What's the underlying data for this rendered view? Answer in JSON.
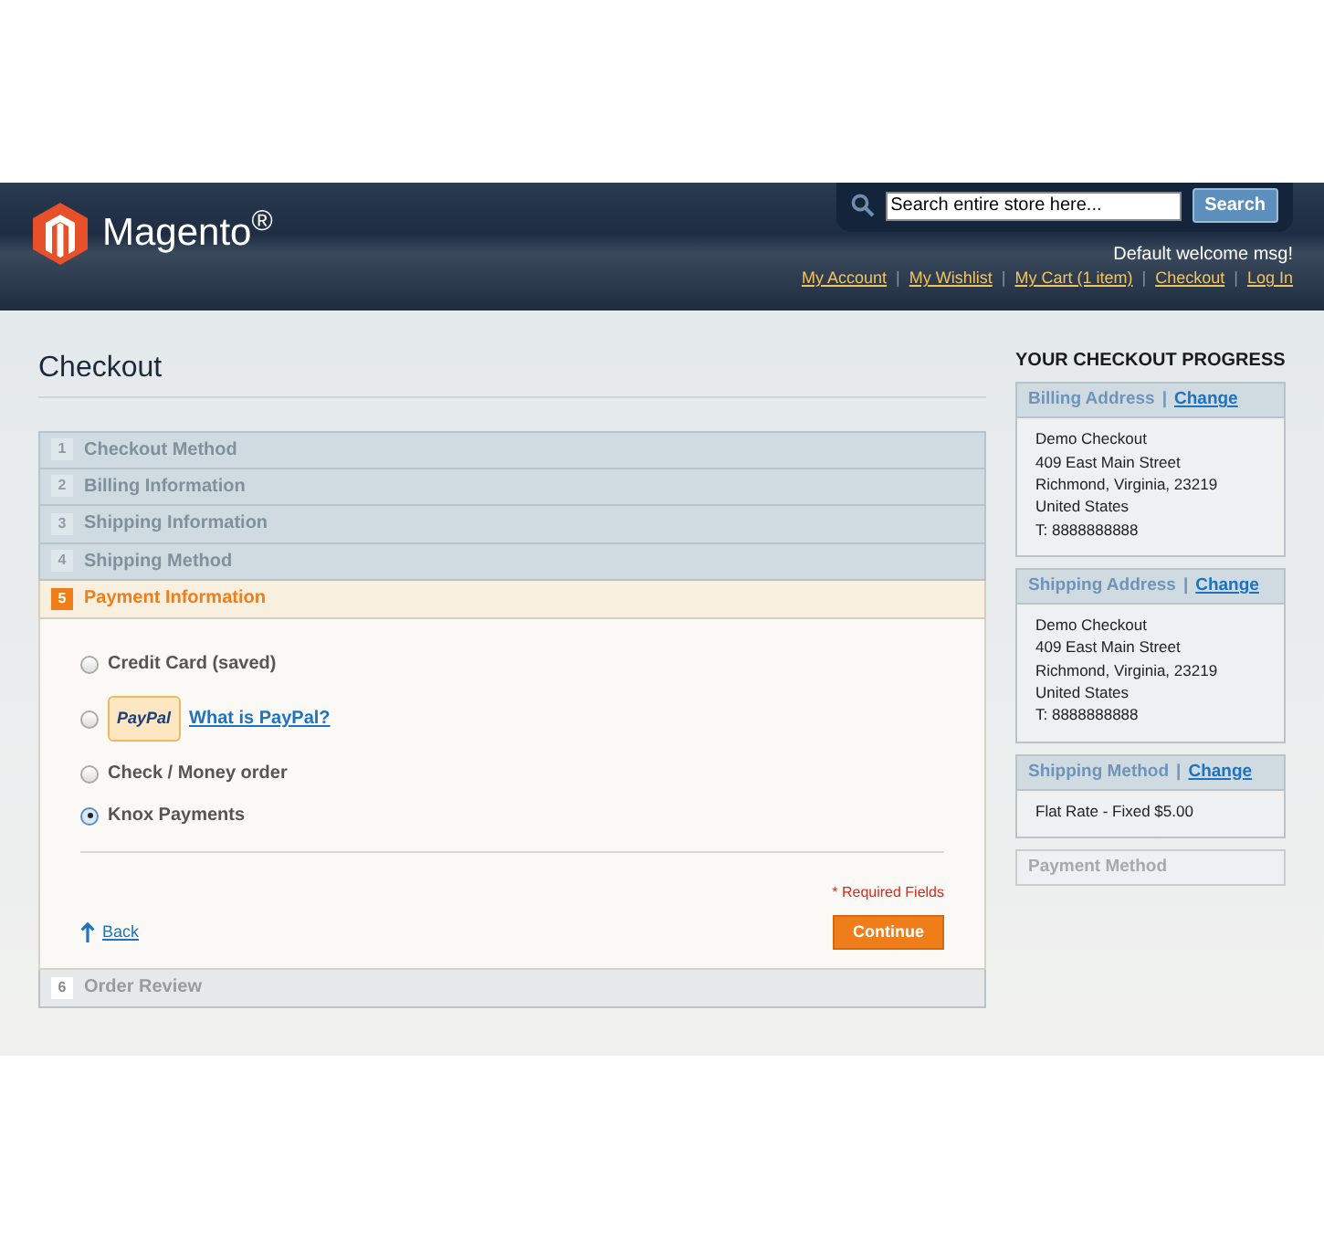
{
  "header": {
    "logo_text": "Magento$^{®}$",
    "search": {
      "value": "Search entire store here...",
      "button": "Search"
    },
    "welcome": "Default welcome msg!",
    "links": [
      "My Account",
      "My Wishlist",
      "My Cart (1 item)",
      "Checkout",
      "Log In"
    ],
    "link_separators": [
      "|",
      "|",
      "|",
      "|"
    ]
  },
  "page_title": "Checkout",
  "steps": [
    {
      "number": "1",
      "label": "Checkout Method",
      "completed": true,
      "active": false
    },
    {
      "number": "2",
      "label": "Billing Information",
      "completed": true,
      "active": false
    },
    {
      "number": "3",
      "label": "Shipping Information",
      "completed": true,
      "active": false
    },
    {
      "number": "4",
      "label": "Shipping Method",
      "completed": true,
      "active": false
    },
    {
      "number": "5",
      "label": "Payment Information",
      "completed": false,
      "active": true
    },
    {
      "number": "6",
      "label": "Order Review",
      "completed": false,
      "active": false
    }
  ],
  "payment_options": [
    {
      "kind": "text",
      "label": "Credit Card (saved)",
      "selected": false
    },
    {
      "kind": "paypal",
      "logo_text": "PayPal",
      "link": "What is PayPal?",
      "selected": false
    },
    {
      "kind": "text",
      "label": "Check / Money order",
      "selected": false
    },
    {
      "kind": "text",
      "label": "Knox Payments",
      "selected": true
    }
  ],
  "required_note": "* Required Fields",
  "back_link": "Back",
  "continue_button": "Continue",
  "progress": {
    "title": "YOUR CHECKOUT PROGRESS",
    "sections": [
      {
        "title": "Billing Address",
        "separator": "|",
        "change": "Change",
        "complete": true,
        "lines": [
          "Demo Checkout",
          "409 East Main Street",
          "Richmond, Virginia, 23219",
          "United States",
          "T: 8888888888"
        ]
      },
      {
        "title": "Shipping Address",
        "separator": "|",
        "change": "Change",
        "complete": true,
        "lines": [
          "Demo Checkout",
          "409 East Main Street",
          "Richmond, Virginia, 23219",
          "United States",
          "T: 8888888888"
        ]
      },
      {
        "title": "Shipping Method",
        "separator": "|",
        "change": "Change",
        "complete": true,
        "lines": [
          "Flat Rate - Fixed $5.00"
        ]
      },
      {
        "title": "Payment Method",
        "complete": false
      }
    ]
  }
}
